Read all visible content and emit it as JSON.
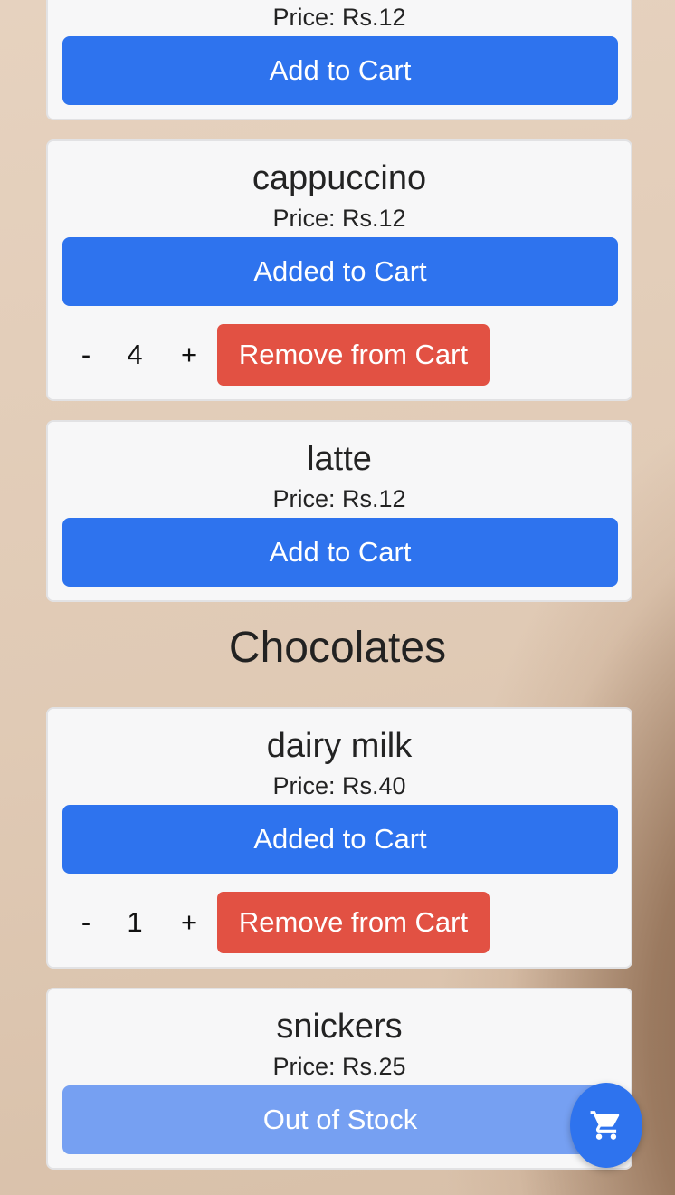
{
  "labels": {
    "price_prefix": "Price: ",
    "add": "Add to Cart",
    "added": "Added to Cart",
    "out_of_stock": "Out of Stock",
    "remove": "Remove from Cart",
    "minus": "-",
    "plus": "+"
  },
  "items": [
    {
      "name": "",
      "price": "Price: Rs.12",
      "button": "Add to Cart"
    },
    {
      "name": "cappuccino",
      "price": "Price: Rs.12",
      "button": "Added to Cart",
      "quantity": "4",
      "remove": "Remove from Cart"
    },
    {
      "name": "latte",
      "price": "Price: Rs.12",
      "button": "Add to Cart"
    }
  ],
  "sections": [
    {
      "title": "Chocolates"
    }
  ],
  "chocolates": [
    {
      "name": "dairy milk",
      "price": "Price: Rs.40",
      "button": "Added to Cart",
      "quantity": "1",
      "remove": "Remove from Cart"
    },
    {
      "name": "snickers",
      "price": "Price: Rs.25",
      "button": "Out of Stock"
    }
  ],
  "colors": {
    "primary": "#2e73ee",
    "primary_disabled": "#76a0f2",
    "danger": "#e25143",
    "card": "#f7f7f8"
  },
  "icons": {
    "cart": "shopping-cart-icon"
  }
}
